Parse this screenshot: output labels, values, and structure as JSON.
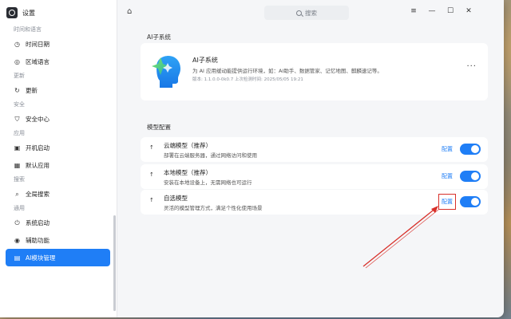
{
  "app": {
    "title": "设置"
  },
  "sidebar": {
    "items": [
      {
        "type": "group",
        "label": "时间和语言"
      },
      {
        "type": "item",
        "label": "时间日期",
        "icon": "clock-icon"
      },
      {
        "type": "item",
        "label": "区域语言",
        "icon": "globe-icon"
      },
      {
        "type": "group",
        "label": "更新"
      },
      {
        "type": "item",
        "label": "更新",
        "icon": "update-icon"
      },
      {
        "type": "group",
        "label": "安全"
      },
      {
        "type": "item",
        "label": "安全中心",
        "icon": "shield-icon"
      },
      {
        "type": "group",
        "label": "应用"
      },
      {
        "type": "item",
        "label": "开机启动",
        "icon": "startup-icon"
      },
      {
        "type": "item",
        "label": "默认应用",
        "icon": "grid-icon"
      },
      {
        "type": "group",
        "label": "搜索"
      },
      {
        "type": "item",
        "label": "全局搜索",
        "icon": "search-icon"
      },
      {
        "type": "group",
        "label": "通用"
      },
      {
        "type": "item",
        "label": "系统启动",
        "icon": "power-icon"
      },
      {
        "type": "item",
        "label": "辅助功能",
        "icon": "accessibility-icon"
      },
      {
        "type": "item",
        "label": "AI模块管理",
        "icon": "ai-icon",
        "active": true
      }
    ]
  },
  "titlebar": {
    "search_placeholder": "搜索"
  },
  "main": {
    "ai_section_title": "AI子系统",
    "ai_card": {
      "name": "AI子系统",
      "description": "为 AI 应用缓动能提供运行环境，如：AI助手、数据管家、记忆地图、麒麟速记等。",
      "meta": "版本: 1.1.0.0-0k0.7    上次检测时间: 2025/05/05 19:21",
      "more": "···"
    },
    "model_section_title": "模型配置",
    "models": [
      {
        "name": "云端模型（推荐）",
        "desc": "部署在云端服务器，通过网络访问和使用",
        "config": "配置",
        "enabled": true
      },
      {
        "name": "本地模型（推荐）",
        "desc": "安装在本地设备上，无需网络也可运行",
        "config": "配置",
        "enabled": true
      },
      {
        "name": "自选模型",
        "desc": "灵活的模型管理方式，满足个性化使用场景",
        "config": "配置",
        "enabled": true
      }
    ]
  },
  "colors": {
    "accent": "#1f7ef6",
    "annotation": "#d8302a"
  }
}
